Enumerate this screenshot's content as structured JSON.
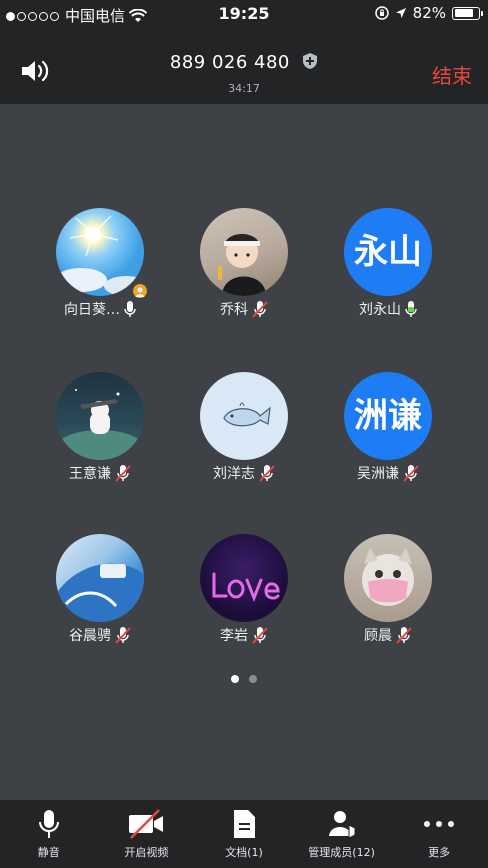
{
  "status_bar": {
    "carrier": "中国电信",
    "time": "19:25",
    "battery": "82%",
    "battery_level": 0.82
  },
  "header": {
    "meeting_id": "889 026 480",
    "duration": "34:17",
    "end_label": "结束"
  },
  "participants": [
    {
      "name": "向日葵…",
      "mic": "on",
      "host": true
    },
    {
      "name": "乔科",
      "mic": "muted"
    },
    {
      "name": "刘永山",
      "mic": "on",
      "avatar_text": "永山"
    },
    {
      "name": "王意谦",
      "mic": "muted"
    },
    {
      "name": "刘洋志",
      "mic": "muted"
    },
    {
      "name": "吴洲谦",
      "mic": "muted",
      "avatar_text": "洲谦"
    },
    {
      "name": "谷晨骋",
      "mic": "muted"
    },
    {
      "name": "李岩",
      "mic": "muted"
    },
    {
      "name": "顾晨",
      "mic": "muted"
    }
  ],
  "pager": {
    "pages": 2,
    "current": 1
  },
  "toolbar": {
    "mute": "静音",
    "video": "开启视频",
    "docs": "文档(1)",
    "members": "管理成员(12)",
    "more": "更多"
  },
  "colors": {
    "end": "#e8473f",
    "mic_on": "#6fd34a",
    "muted": "#e8473f",
    "avatar_blue": "#1e7df5"
  }
}
